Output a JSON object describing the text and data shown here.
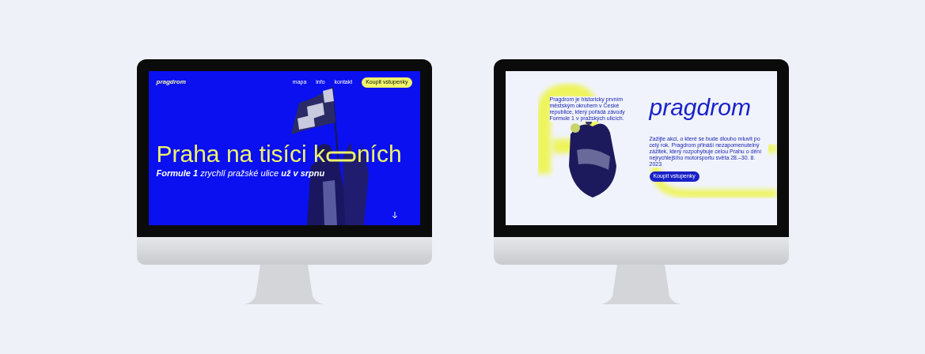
{
  "left_screen": {
    "logo": "pragdrom",
    "nav": [
      "mapa",
      "info",
      "kontakt"
    ],
    "cta": "Koupit vstupenky",
    "headline_start": "Praha na tisíci k",
    "headline_end": "ních",
    "subtitle": "**Formule 1** zrychlí pražské ulice **už v srpnu**"
  },
  "right_screen": {
    "intro": "Pragdrom je historicky prvním městským okruhem v České republice, který pořádá závody Formule 1 v pražských ulicích.",
    "logo": "pragdrom",
    "text": "Zažijte akci, o které se bude dlouho mluvit po celý rok. Pragdrom přináší nezapomenutelný zážitek, který rozpohybuje celou Prahu o dění nejrychlejšího motorsportu světa 28.–30. 8. 2023",
    "cta": "Koupit vstupenky"
  }
}
